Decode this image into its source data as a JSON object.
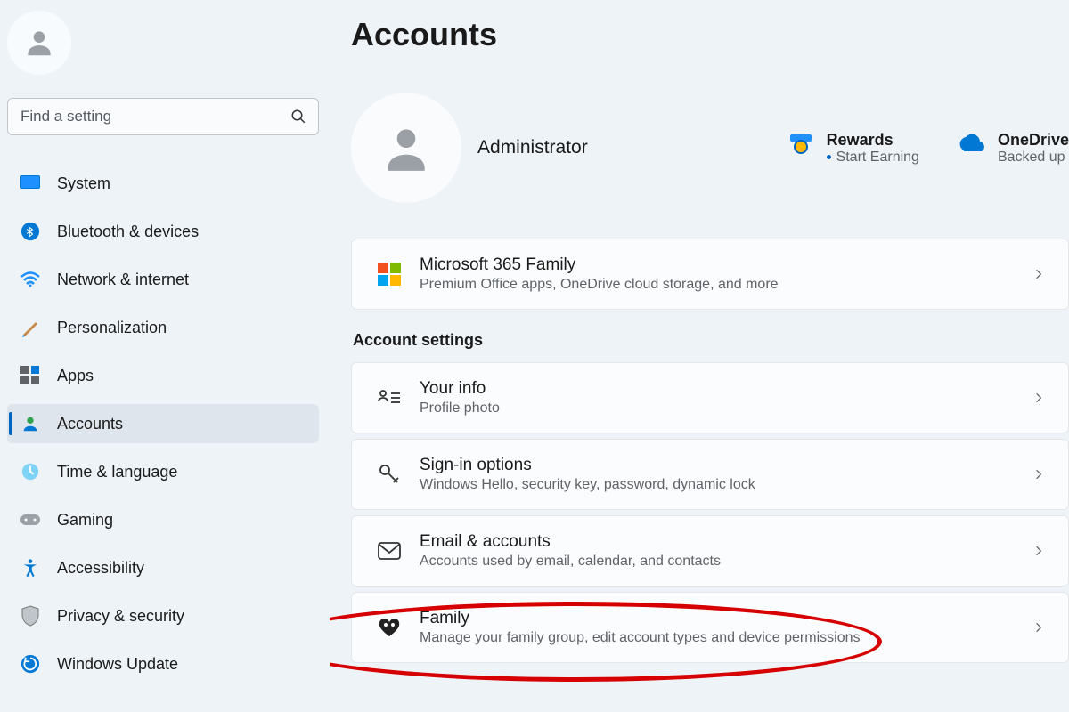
{
  "search": {
    "placeholder": "Find a setting"
  },
  "sidebar": {
    "items": [
      {
        "label": "System"
      },
      {
        "label": "Bluetooth & devices"
      },
      {
        "label": "Network & internet"
      },
      {
        "label": "Personalization"
      },
      {
        "label": "Apps"
      },
      {
        "label": "Accounts"
      },
      {
        "label": "Time & language"
      },
      {
        "label": "Gaming"
      },
      {
        "label": "Accessibility"
      },
      {
        "label": "Privacy & security"
      },
      {
        "label": "Windows Update"
      }
    ]
  },
  "page": {
    "title": "Accounts",
    "username": "Administrator",
    "rewards": {
      "title": "Rewards",
      "sub": "Start Earning"
    },
    "onedrive": {
      "title": "OneDrive",
      "sub": "Backed up"
    },
    "m365": {
      "title": "Microsoft 365 Family",
      "sub": "Premium Office apps, OneDrive cloud storage, and more"
    },
    "section_label": "Account settings",
    "cards": [
      {
        "title": "Your info",
        "sub": "Profile photo"
      },
      {
        "title": "Sign-in options",
        "sub": "Windows Hello, security key, password, dynamic lock"
      },
      {
        "title": "Email & accounts",
        "sub": "Accounts used by email, calendar, and contacts"
      },
      {
        "title": "Family",
        "sub": "Manage your family group, edit account types and device permissions"
      }
    ]
  }
}
